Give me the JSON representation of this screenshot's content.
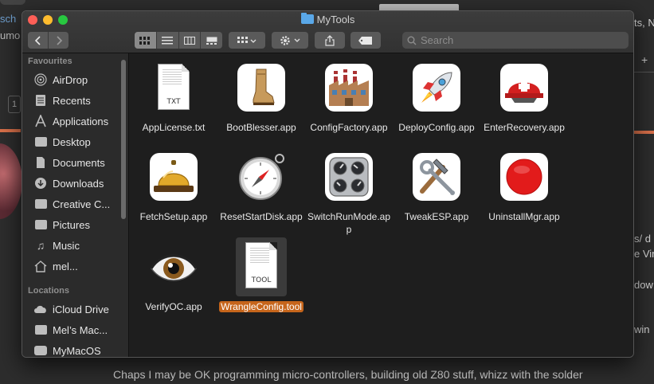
{
  "window": {
    "title": "MyTools"
  },
  "toolbar": {
    "back_icon": "chevron-left-icon",
    "forward_icon": "chevron-right-icon",
    "search_placeholder": "Search"
  },
  "sidebar": {
    "favourites_header": "Favourites",
    "favourites": [
      {
        "label": "AirDrop",
        "icon": "airdrop-icon"
      },
      {
        "label": "Recents",
        "icon": "recents-icon"
      },
      {
        "label": "Applications",
        "icon": "applications-icon"
      },
      {
        "label": "Desktop",
        "icon": "desktop-icon"
      },
      {
        "label": "Documents",
        "icon": "documents-icon"
      },
      {
        "label": "Downloads",
        "icon": "downloads-icon"
      },
      {
        "label": "Creative C...",
        "icon": "folder-icon"
      },
      {
        "label": "Pictures",
        "icon": "pictures-icon"
      },
      {
        "label": "Music",
        "icon": "music-icon"
      },
      {
        "label": "mel...",
        "icon": "home-icon"
      }
    ],
    "locations_header": "Locations",
    "locations": [
      {
        "label": "iCloud Drive",
        "icon": "cloud-icon"
      },
      {
        "label": "Mel’s Mac...",
        "icon": "computer-icon"
      },
      {
        "label": "MyMacOS",
        "icon": "disk-icon"
      }
    ]
  },
  "files": [
    {
      "name": "AppLicense.txt",
      "kind": "doc",
      "ext": "TXT"
    },
    {
      "name": "BootBlesser.app",
      "kind": "app",
      "icon": "boot-icon"
    },
    {
      "name": "ConfigFactory.app",
      "kind": "app",
      "icon": "factory-icon"
    },
    {
      "name": "DeployConfig.app",
      "kind": "app",
      "icon": "rocket-icon"
    },
    {
      "name": "EnterRecovery.app",
      "kind": "app",
      "icon": "rescue-helmet-icon"
    },
    {
      "name": "FetchSetup.app",
      "kind": "app",
      "icon": "bell-icon"
    },
    {
      "name": "ResetStartDisk.app",
      "kind": "app",
      "icon": "compass-icon"
    },
    {
      "name": "SwitchRunMode.app",
      "kind": "app",
      "icon": "control-panel-icon"
    },
    {
      "name": "TweakESP.app",
      "kind": "app",
      "icon": "hammer-wrench-icon"
    },
    {
      "name": "UninstallMgr.app",
      "kind": "app",
      "icon": "red-circle-icon"
    },
    {
      "name": "VerifyOC.app",
      "kind": "app",
      "icon": "eye-icon"
    },
    {
      "name": "WrangleConfig.tool",
      "kind": "doc",
      "ext": "TOOL",
      "selected": true
    }
  ],
  "background": {
    "left_name": "sch",
    "left_sub": "umo",
    "right_lines": [
      "ts, N",
      "s/ d",
      "e Vir",
      "dow",
      "win"
    ],
    "bottom_text": "Chaps I may be OK programming micro-controllers, building old Z80 stuff, whizz with the solder",
    "square_label": "1"
  }
}
